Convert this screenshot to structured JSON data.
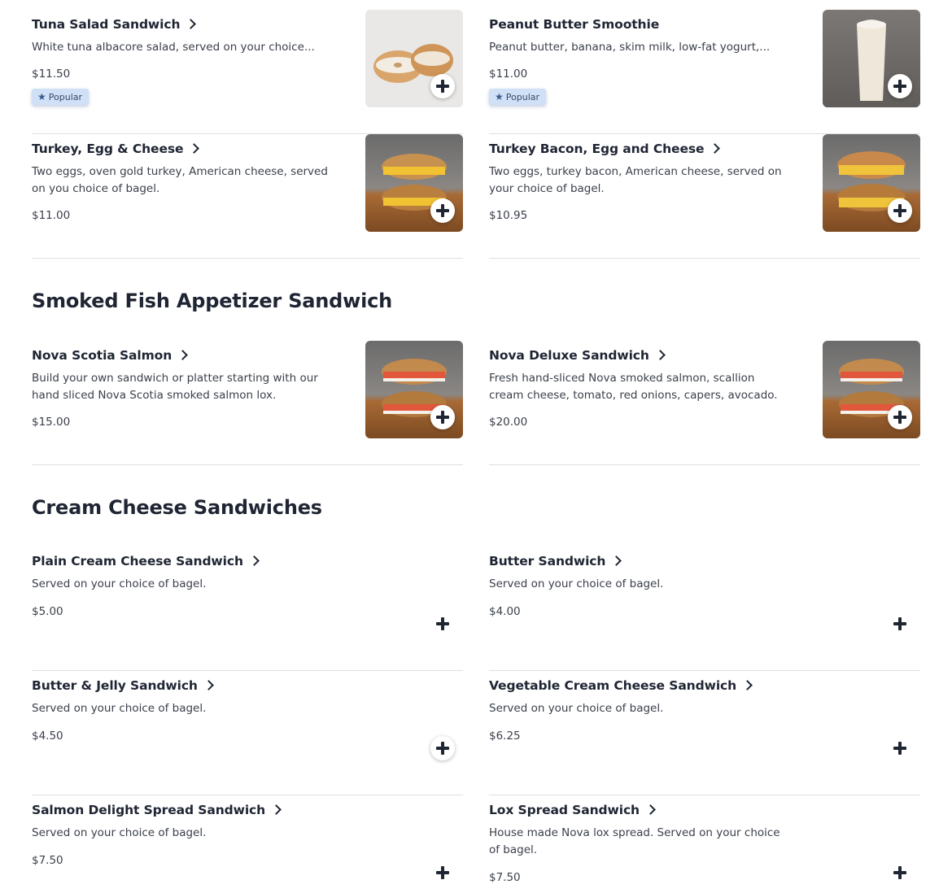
{
  "popular_label": "Popular",
  "top_items": [
    {
      "name": "Tuna Salad Sandwich",
      "desc": "White tuna albacore salad, served on your choice...",
      "price": "$11.50",
      "popular": true,
      "image": "bagel-tuna"
    },
    {
      "name": "Peanut Butter Smoothie",
      "desc": "Peanut butter, banana, skim milk, low-fat yogurt,...",
      "price": "$11.00",
      "popular": true,
      "image": "smoothie"
    },
    {
      "name": "Turkey, Egg & Cheese",
      "desc": "Two eggs, oven gold turkey, American cheese, served on you choice of bagel.",
      "price": "$11.00",
      "image": "egg-sandwich"
    },
    {
      "name": "Turkey Bacon, Egg and Cheese",
      "desc": "Two eggs, turkey bacon, American cheese, served on your choice of bagel.",
      "price": "$10.95",
      "image": "egg-sandwich"
    }
  ],
  "sections": [
    {
      "title": "Smoked Fish Appetizer Sandwich",
      "items": [
        {
          "name": "Nova Scotia Salmon",
          "desc": "Build your own sandwich or platter starting with our hand sliced Nova Scotia smoked salmon lox.",
          "price": "$15.00",
          "image": "lox-sandwich"
        },
        {
          "name": "Nova Deluxe Sandwich",
          "desc": "Fresh hand-sliced Nova smoked salmon, scallion cream cheese, tomato, red onions, capers, avocado.",
          "price": "$20.00",
          "image": "lox-sandwich"
        }
      ]
    },
    {
      "title": "Cream Cheese Sandwiches",
      "items": [
        {
          "name": "Plain Cream Cheese Sandwich",
          "desc": "Served on your choice of bagel.",
          "price": "$5.00"
        },
        {
          "name": "Butter Sandwich",
          "desc": "Served on your choice of bagel.",
          "price": "$4.00"
        },
        {
          "name": "Butter & Jelly Sandwich",
          "desc": "Served on your choice of bagel.",
          "price": "$4.50"
        },
        {
          "name": "Vegetable Cream Cheese Sandwich",
          "desc": "Served on your choice of bagel.",
          "price": "$6.25"
        },
        {
          "name": "Salmon Delight Spread Sandwich",
          "desc": "Served on your choice of bagel.",
          "price": "$7.50"
        },
        {
          "name": "Lox Spread Sandwich",
          "desc": "House made Nova lox spread. Served on your choice of bagel.",
          "price": "$7.50"
        }
      ]
    }
  ]
}
